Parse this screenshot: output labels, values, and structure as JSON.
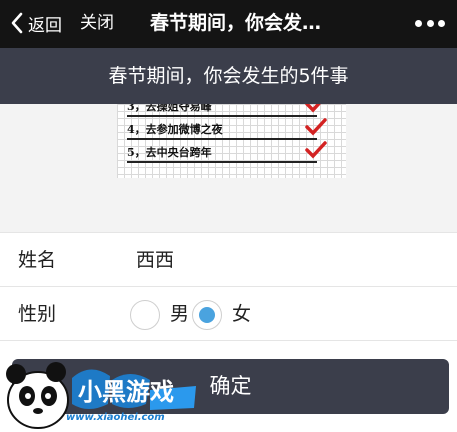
{
  "topbar": {
    "back_label": "返回",
    "close_label": "关闭",
    "title": "春节期间，你会发…",
    "more_icon": "more-dots-icon"
  },
  "banner": {
    "text": "春节期间，你会发生的5件事"
  },
  "preview_image": {
    "rows": [
      {
        "text": "3，去操姐夺易峰"
      },
      {
        "text": "4，去参加微博之夜"
      },
      {
        "text": "5，去中央台跨年"
      }
    ],
    "check_icon": "red-check-icon"
  },
  "form": {
    "name_label": "姓名",
    "name_value": "西西",
    "gender_label": "性别",
    "gender_options": [
      {
        "label": "男",
        "selected": false
      },
      {
        "label": "女",
        "selected": true
      }
    ]
  },
  "confirm_label": "确定",
  "watermark": {
    "logo_text": "小黑游戏",
    "url": "www.xiaohei.com"
  },
  "colors": {
    "topbar": "#141414",
    "banner": "#3b3e4b",
    "radio_selected": "#4aa3df",
    "check": "#d32222"
  }
}
